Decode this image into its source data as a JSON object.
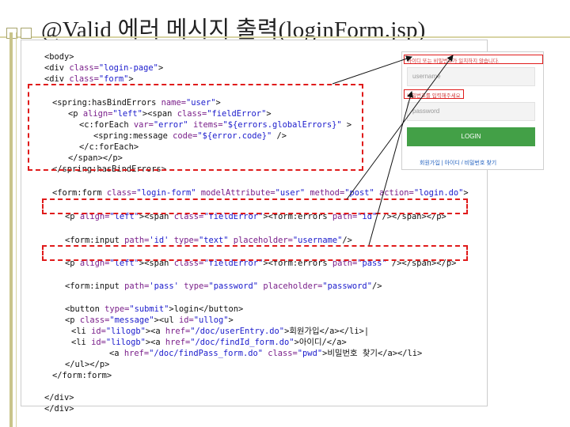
{
  "slide": {
    "title": "@Valid 에러 메시지 출력(loginForm.jsp)"
  },
  "code_lines": {
    "l1": {
      "a": "<body>"
    },
    "l2": {
      "a": "<div ",
      "b": "class=",
      "c": "\"login-page\"",
      "d": ">"
    },
    "l3": {
      "a": "<div ",
      "b": "class=",
      "c": "\"form\"",
      "d": ">"
    },
    "l4": {
      "a": "<spring:hasBindErrors ",
      "b": "name=",
      "c": "\"user\"",
      "d": ">"
    },
    "l5": {
      "a": "<p ",
      "b": "align=",
      "c": "\"left\"",
      "d": "><span ",
      "e": "class=",
      "f": "\"fieldError\"",
      "g": ">"
    },
    "l6": {
      "a": "<c:forEach ",
      "b": "var=",
      "c": "\"error\"",
      "d": " ",
      "e": "items=",
      "f": "\"${errors.globalErrors}\"",
      "g": " >"
    },
    "l7": {
      "a": "<spring:message ",
      "b": "code=",
      "c": "\"${error.code}\"",
      "d": " />"
    },
    "l8": {
      "a": "</c:forEach>"
    },
    "l9": {
      "a": "</span></p>"
    },
    "l10": {
      "a": "</spring:hasBindErrors>"
    },
    "l11": {
      "a": "<form:form ",
      "b": "class=",
      "c": "\"login-form\"",
      "d": " ",
      "e": "modelAttribute=",
      "f": "\"user\"",
      "g": " ",
      "h": "method=",
      "i": "\"post\"",
      "j": " ",
      "k": "action=",
      "l": "\"login.do\"",
      "m": ">"
    },
    "l12": {
      "a": "<p ",
      "b": "align=",
      "c": "\"left\"",
      "d": "><span ",
      "e": "class=",
      "f": "\"fieldError\"",
      "g": "><form:errors ",
      "h": "path=",
      "i": "\"id\"",
      "j": " /></span></p>"
    },
    "l13": {
      "a": "<form:input ",
      "b": "path=",
      "c": "'id'",
      "d": " ",
      "e": "type=",
      "f": "\"text\"",
      "g": " ",
      "h": "placeholder=",
      "i": "\"username\"",
      "j": "/>"
    },
    "l14": {
      "a": "<p ",
      "b": "align=",
      "c": "\"left\"",
      "d": "><span ",
      "e": "class=",
      "f": "\"fieldError\"",
      "g": "><form:errors ",
      "h": "path=",
      "i": "\"pass\"",
      "j": " /></span></p>"
    },
    "l15": {
      "a": "<form:input ",
      "b": "path=",
      "c": "'pass'",
      "d": " ",
      "e": "type=",
      "f": "\"password\"",
      "g": " ",
      "h": "placeholder=",
      "i": "\"password\"",
      "j": "/>"
    },
    "l16": {
      "a": "<button ",
      "b": "type=",
      "c": "\"submit\"",
      "d": ">login</button>"
    },
    "l17": {
      "a": "<p ",
      "b": "class=",
      "c": "\"message\"",
      "d": "><ul ",
      "e": "id=",
      "f": "\"ullog\"",
      "g": ">"
    },
    "l18": {
      "a": "<li ",
      "b": "id=",
      "c": "\"lilogb\"",
      "d": "><a ",
      "e": "href=",
      "f": "\"/doc/userEntry.do\"",
      "g": ">회원가입</a></li>|"
    },
    "l19": {
      "a": "<li ",
      "b": "id=",
      "c": "\"lilogb\"",
      "d": "><a ",
      "e": "href=",
      "f": "\"/doc/findId_form.do\"",
      "g": ">아이디/</a>"
    },
    "l20": {
      "a": "<a ",
      "b": "href=",
      "c": "\"/doc/findPass_form.do\"",
      "d": " ",
      "e": "class=",
      "f": "\"pwd\"",
      "g": ">비밀번호 찾기</a></li>"
    },
    "l21": {
      "a": "</ul></p>"
    },
    "l22": {
      "a": "</form:form>"
    },
    "l23": {
      "a": "</div>"
    },
    "l24": {
      "a": "</div>"
    }
  },
  "preview": {
    "global_error_1": "아이디 또는 비밀번호가 일치하지 않습니다.",
    "username_placeholder": "username",
    "pass_error": "비밀번호를 입력해주세요",
    "password_placeholder": "password",
    "login_button": "LOGIN",
    "links": "회원가입 | 아이디 / 비밀번호 찾기"
  },
  "colors": {
    "highlight": "#e01b1b",
    "tag": "#111111",
    "attribute": "#7a1f8a",
    "string": "#1a1acc",
    "login_button": "#43a047"
  }
}
